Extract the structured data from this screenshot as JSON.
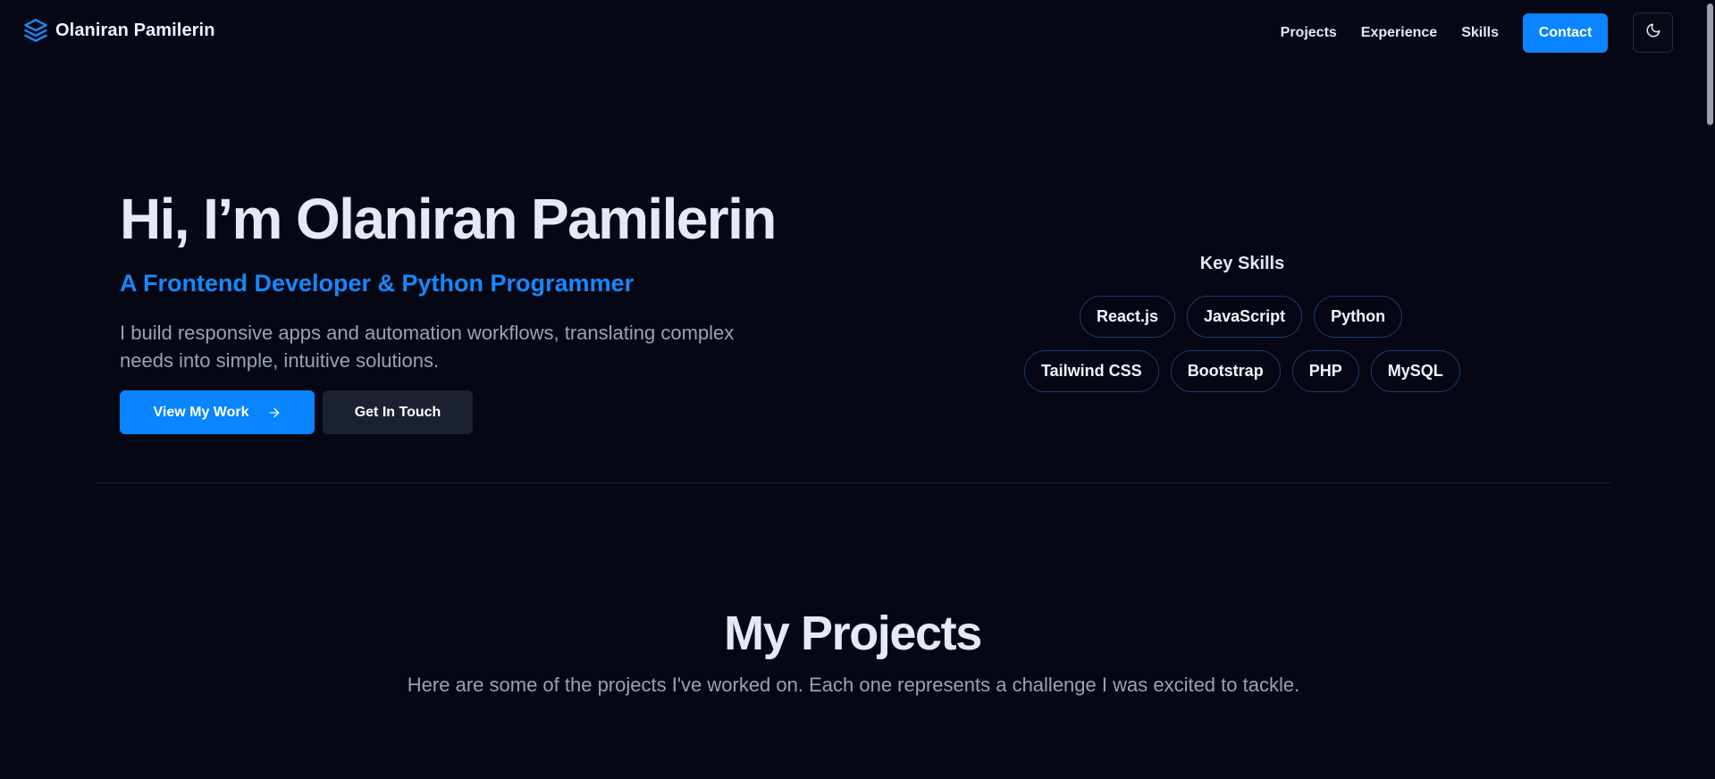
{
  "header": {
    "brand_name": "Olaniran Pamilerin",
    "brand_icon": "layers-icon",
    "nav": [
      "Projects",
      "Experience",
      "Skills"
    ],
    "contact_label": "Contact",
    "theme_icon": "moon-icon"
  },
  "hero": {
    "title": "Hi, I’m Olaniran Pamilerin",
    "subtitle": "A Frontend Developer & Python Programmer",
    "description": "I build responsive apps and automation workflows, translating complex needs into simple, intuitive solutions.",
    "primary_button": "View My Work",
    "primary_icon": "arrow-right-icon",
    "secondary_button": "Get In Touch"
  },
  "skills": {
    "title": "Key Skills",
    "row1": [
      "React.js",
      "JavaScript",
      "Python"
    ],
    "row2": [
      "Tailwind CSS",
      "Bootstrap",
      "PHP",
      "MySQL"
    ]
  },
  "projects": {
    "title": "My Projects",
    "description": "Here are some of the projects I've worked on. Each one represents a challenge I was excited to tackle."
  },
  "colors": {
    "background": "#050814",
    "accent": "#0a84ff",
    "chip_border": "#1a3a6e",
    "muted_text": "#98a2b6"
  }
}
